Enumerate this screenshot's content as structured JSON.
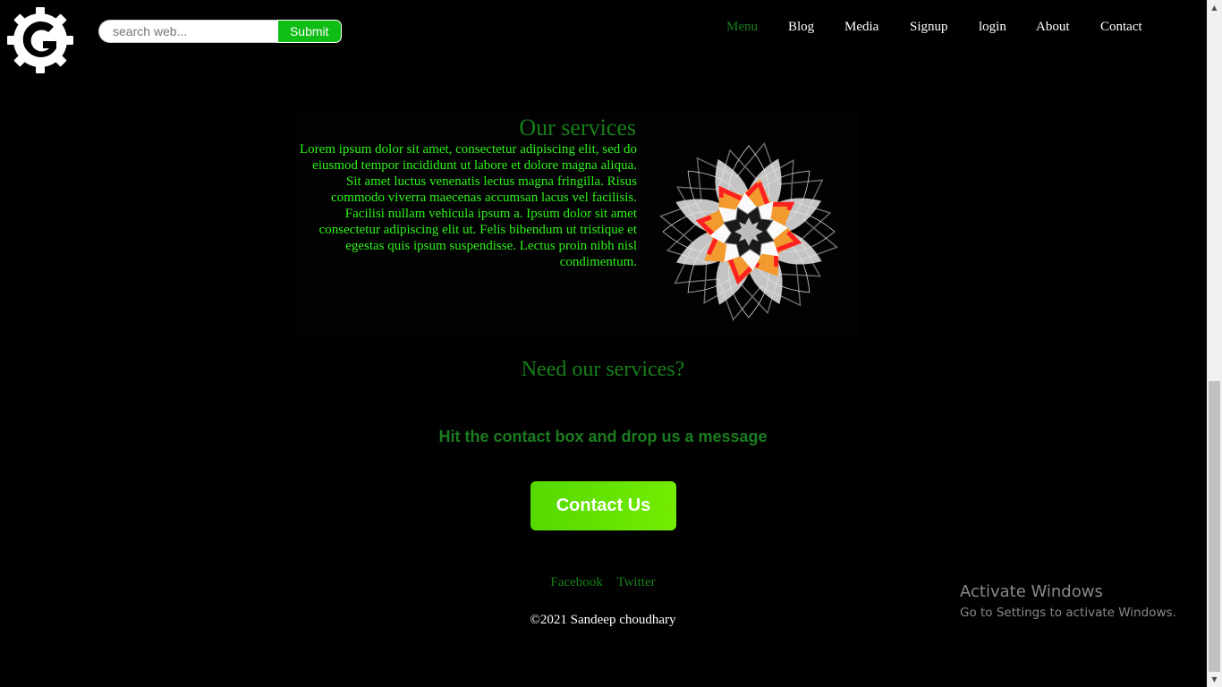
{
  "header": {
    "search": {
      "placeholder": "search web...",
      "submit_label": "Submit"
    },
    "nav": [
      {
        "label": "Menu",
        "active": true
      },
      {
        "label": "Blog"
      },
      {
        "label": "Media"
      },
      {
        "label": "Signup"
      },
      {
        "label": "login"
      },
      {
        "label": "About"
      },
      {
        "label": "Contact"
      }
    ]
  },
  "services": {
    "title": "Our services",
    "body": "Lorem ipsum dolor sit amet, consectetur adipiscing elit, sed do eiusmod tempor incididunt ut labore et dolore magna aliqua. Sit amet luctus venenatis lectus magna fringilla. Risus commodo viverra maecenas accumsan lacus vel facilisis. Facilisi nullam vehicula ipsum a. Ipsum dolor sit amet consectetur adipiscing elit ut. Felis bibendum ut tristique et egestas quis ipsum suspendisse. Lectus proin nibh nisl condimentum."
  },
  "cta": {
    "heading": "Need our services?",
    "subheading": "Hit the contact box and drop us a message",
    "button_label": "Contact Us"
  },
  "footer": {
    "social": [
      "Facebook",
      "Twitter"
    ],
    "copyright": "©2021 Sandeep choudhary"
  },
  "watermark": {
    "title": "Activate Windows",
    "subtitle": "Go to Settings to activate Windows."
  },
  "colors": {
    "accent_green": "#17801a",
    "text_green": "#2ef21a",
    "submit_green": "#0fbd15",
    "button_green": "#6ae800"
  },
  "icons": {
    "logo": "gear-g-logo-icon",
    "illustration": "geometric-flower-star"
  }
}
